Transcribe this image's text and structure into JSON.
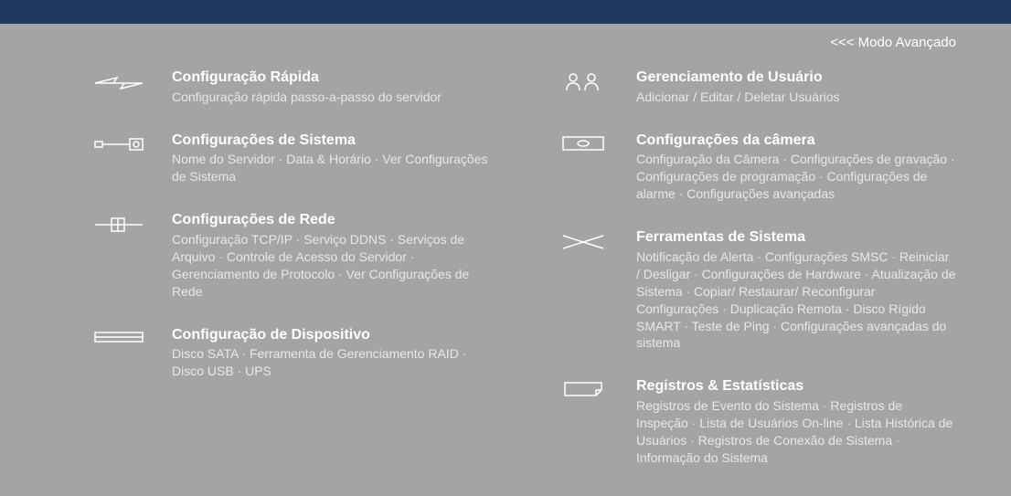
{
  "header": {
    "mode_link": "<<< Modo Avançado"
  },
  "left": [
    {
      "title": "Configuração Rápida",
      "desc": "Configuração rápida passo-a-passo do servidor"
    },
    {
      "title": "Configurações de Sistema",
      "desc": "Nome do Servidor · Data & Horário · Ver Configurações de Sistema"
    },
    {
      "title": "Configurações de Rede",
      "desc": "Configuração TCP/IP · Serviço DDNS · Serviços de Arquivo · Controle de Acesso do Servidor · Gerenciamento de Protocolo · Ver Configurações de Rede"
    },
    {
      "title": "Configuração de Dispositivo",
      "desc": "Disco SATA · Ferramenta de Gerenciamento RAID · Disco USB · UPS"
    }
  ],
  "right": [
    {
      "title": "Gerenciamento de Usuário",
      "desc": "Adicionar / Editar / Deletar Usuários"
    },
    {
      "title": "Configurações da câmera",
      "desc": "Configuração da Câmera · Configurações de gravação · Configurações de programação · Configurações de alarme · Configurações avançadas"
    },
    {
      "title": "Ferramentas de Sistema",
      "desc": "Notificação de Alerta · Configurações SMSC · Reiniciar / Desligar · Configurações de Hardware · Atualização de Sistema · Copiar/ Restaurar/ Reconfigurar Configurações · Duplicação Remota · Disco Rígido SMART · Teste de Ping · Configurações avançadas do sistema"
    },
    {
      "title": "Registros & Estatísticas",
      "desc": "Registros de Evento do Sistema · Registros de Inspeção · Lista de Usuários On-line · Lista Histórica de Usuários · Registros de Conexão de Sistema · Informação do Sistema"
    }
  ]
}
